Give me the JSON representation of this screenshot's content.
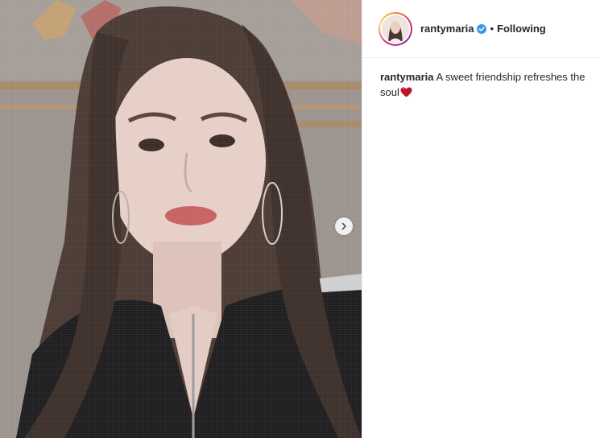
{
  "post": {
    "username": "rantymaria",
    "separator": "•",
    "follow_status": "Following",
    "caption_user": "rantymaria",
    "caption_text": "A sweet friendship refreshes the soul",
    "caption_emoji": "red-heart-icon"
  },
  "colors": {
    "verified_badge": "#3897f0",
    "heart": "#c0132a",
    "text": "#262626",
    "divider": "#efefef"
  }
}
